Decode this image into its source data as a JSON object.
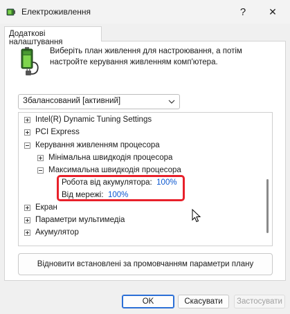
{
  "window": {
    "title": "Електроживлення",
    "help_glyph": "?",
    "close_glyph": "✕",
    "icon": "power-options-icon"
  },
  "tab": {
    "label": "Додаткові налаштування"
  },
  "intro": {
    "text": "Виберіть план живлення для настроювання, а потім настройте керування живленням комп'ютера.",
    "icon": "battery-plug-icon"
  },
  "plan_select": {
    "value": "Збалансований [активний]",
    "icon": "chevron-down-icon"
  },
  "tree": {
    "items": [
      {
        "label": "Intel(R) Dynamic Tuning Settings",
        "expander": "+"
      },
      {
        "label": "PCI Express",
        "expander": "+"
      },
      {
        "label": "Керування живленням процесора",
        "expander": "−"
      },
      {
        "label": "Мінімальна швидкодія процесора",
        "expander": "+"
      },
      {
        "label": "Максимальна швидкодія процесора",
        "expander": "−"
      },
      {
        "label": "Робота від акумулятора:",
        "value": "100%"
      },
      {
        "label": "Від мережі:",
        "value": "100%"
      },
      {
        "label": "Екран",
        "expander": "+"
      },
      {
        "label": "Параметри мультимедіа",
        "expander": "+"
      },
      {
        "label": "Акумулятор",
        "expander": "+"
      }
    ]
  },
  "highlight_color": "#e8202a",
  "value_color": "#0b57d0",
  "restore_button": {
    "label": "Відновити встановлені за промовчанням параметри плану"
  },
  "footer": {
    "ok_label": "OK",
    "cancel_label": "Скасувати",
    "apply_label": "Застосувати"
  }
}
